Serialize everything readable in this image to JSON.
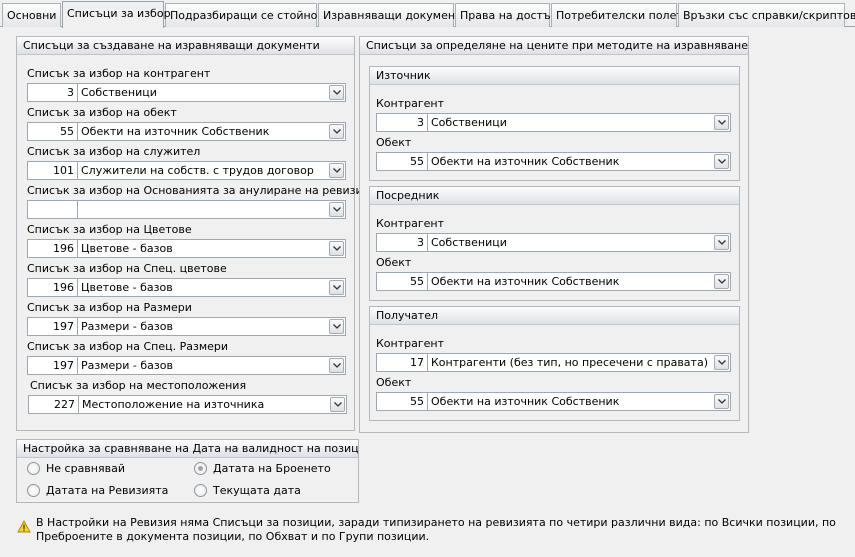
{
  "tabs": [
    "Основни",
    "Списъци за избор",
    "Подразбиращи се стойности",
    "Изравняващи документи",
    "Права на достъп",
    "Потребителски полета",
    "Връзки със справки/скриптове"
  ],
  "left_panel": {
    "title": "Списъци за създаване на изравняващи документи",
    "fields": [
      {
        "label": "Списък за избор на контрагент",
        "num": "3",
        "value": "Собственици"
      },
      {
        "label": "Списък за избор на обект",
        "num": "55",
        "value": "Обекти на източник Собственик"
      },
      {
        "label": "Списък за избор на служител",
        "num": "101",
        "value": "Служители на собств. с трудов договор"
      },
      {
        "label": "Списък за избор на Основанията за анулиране на ревизията",
        "num": "",
        "value": ""
      },
      {
        "label": "Списък за избор на Цветове",
        "num": "196",
        "value": "Цветове - базов"
      },
      {
        "label": "Списък за избор на Спец. цветове",
        "num": "196",
        "value": "Цветове - базов"
      },
      {
        "label": "Списък за избор на Размери",
        "num": "197",
        "value": "Размери - базов"
      },
      {
        "label": "Списък за избор на Спец. Размери",
        "num": "197",
        "value": "Размери - базов"
      },
      {
        "label": "Списък за избор на местоположения",
        "num": "227",
        "value": "Местоположение на източника"
      }
    ]
  },
  "right_panel": {
    "title": "Списъци за определяне на цените при методите на изравняване",
    "groups": [
      {
        "title": "Източник",
        "c_label": "Контрагент",
        "c_num": "3",
        "c_value": "Собственици",
        "o_label": "Обект",
        "o_num": "55",
        "o_value": "Обекти на източник Собственик"
      },
      {
        "title": "Посредник",
        "c_label": "Контрагент",
        "c_num": "3",
        "c_value": "Собственици",
        "o_label": "Обект",
        "o_num": "55",
        "o_value": "Обекти на източник Собственик"
      },
      {
        "title": "Получател",
        "c_label": "Контрагент",
        "c_num": "17",
        "c_value": "Контрагенти (без тип, но пресечени с правата)",
        "o_label": "Обект",
        "o_num": "55",
        "o_value": "Обекти на източник Собственик"
      }
    ]
  },
  "date_panel": {
    "title": "Настройка за сравняване на Дата на валидност на позиция с :",
    "options": [
      "Не сравнявай",
      "Датата на Броенето",
      "Датата на Ревизията",
      "Текущата дата"
    ],
    "selected": "Датата на Броенето"
  },
  "note": "В Настройки на Ревизия няма Списъци за позиции, заради типизирането на ревизията по четири различни вида: по Всички позиции, по Преброените в документа позиции, по Обхват и по Групи позиции."
}
